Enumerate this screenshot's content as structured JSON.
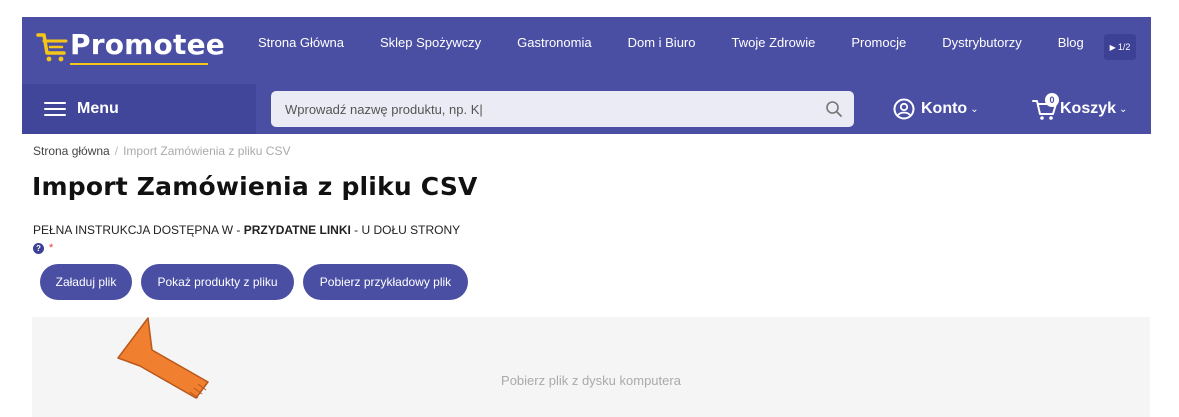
{
  "header": {
    "logo_text": "Promotee",
    "nav": [
      "Strona Główna",
      "Sklep Spożywczy",
      "Gastronomia",
      "Dom i Biuro",
      "Twoje Zdrowie",
      "Promocje",
      "Dystrybutorzy",
      "Blog"
    ],
    "pager": "1/2",
    "menu_label": "Menu",
    "search": {
      "value": "",
      "placeholder": "Wprowadź nazwę produktu, np. K|"
    },
    "account_label": "Konto",
    "cart_label": "Koszyk",
    "cart_count": "0"
  },
  "breadcrumb": {
    "home": "Strona główna",
    "separator": "/",
    "current": "Import Zamówienia z pliku CSV"
  },
  "page_title": "Import Zamówienia z pliku CSV",
  "instruction": {
    "prefix": "PEŁNA INSTRUKCJA DOSTĘPNA W - ",
    "bold": "PRZYDATNE LINKI",
    "suffix": " - U DOŁU STRONY"
  },
  "help": {
    "icon_glyph": "?",
    "required_mark": "*"
  },
  "buttons": {
    "upload": "Załaduj plik",
    "show_products": "Pokaż produkty z pliku",
    "download_sample": "Pobierz przykładowy plik"
  },
  "dropzone": {
    "text": "Pobierz plik z dysku komputera"
  },
  "colors": {
    "brand": "#4a4fa3",
    "brand_dark": "#42469a",
    "logo_accent": "#f5c518",
    "annotation_arrow": "#f07f2f"
  }
}
